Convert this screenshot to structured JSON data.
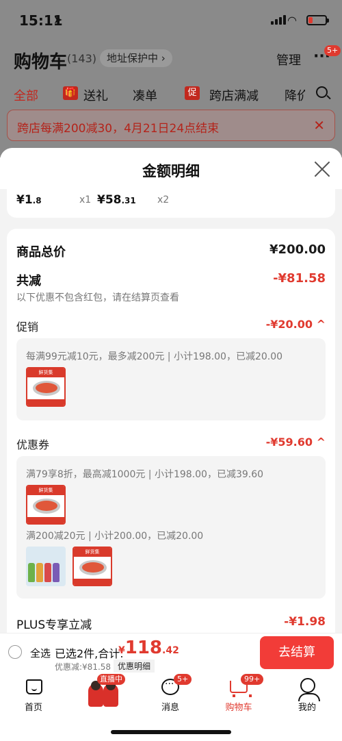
{
  "status": {
    "time": "15:11",
    "location_icon": "location-arrow-icon"
  },
  "header": {
    "title": "购物车",
    "count": "(143)",
    "address": "地址保护中 ›",
    "manage": "管理",
    "more": "···",
    "more_badge": "5+"
  },
  "tabs": [
    {
      "label": "全部",
      "active": true
    },
    {
      "label": "送礼"
    },
    {
      "label": "凑单"
    },
    {
      "label": "跨店满减",
      "icon_text": "促"
    },
    {
      "label": "降价"
    }
  ],
  "banner": {
    "text": "跨店每满200减30，4月21日24点结束",
    "close": "✕"
  },
  "sheet": {
    "title": "金额明细",
    "top_items": [
      {
        "price": "¥1",
        "cents": ".8",
        "qty": "x1"
      },
      {
        "price": "¥58",
        "cents": ".31",
        "qty": "x2"
      }
    ],
    "total_label": "商品总价",
    "total_value": "¥200.00",
    "reduce_label": "共减",
    "reduce_value": "-¥81.58",
    "reduce_note": "以下优惠不包含红包，请在结算页查看",
    "promo_label": "促销",
    "promo_value": "-¥20.00 ^",
    "promo_rule": "每满99元减10元，最多减200元 | 小计198.00，已减20.00",
    "coupon_label": "优惠券",
    "coupon_value": "-¥59.60 ^",
    "coupon_rule1": "满79享8折，最高减1000元 | 小计198.00，已减39.60",
    "coupon_rule2": "满200减20元 | 小计200.00，已减20.00",
    "plus_label": "PLUS专享立减",
    "plus_value": "-¥1.98"
  },
  "bottom": {
    "select_all": "全选",
    "selected": "已选2件,合计:",
    "currency": "¥",
    "total_int": "118",
    "total_dec": ".42",
    "discount": "优惠减:¥81.58",
    "detail_button": "优惠明细",
    "checkout": "去结算"
  },
  "nav": [
    {
      "label": "首页",
      "icon": "home-icon"
    },
    {
      "label": "",
      "icon": "live-stream-icon",
      "badge": "直播中"
    },
    {
      "label": "消息",
      "icon": "message-icon",
      "badge": "5+"
    },
    {
      "label": "购物车",
      "icon": "cart-icon",
      "badge": "99+",
      "active": true
    },
    {
      "label": "我的",
      "icon": "profile-icon"
    }
  ],
  "colors": {
    "accent": "#e03a2f",
    "checkout": "#f23c38",
    "dim": "#8a8a8a"
  }
}
